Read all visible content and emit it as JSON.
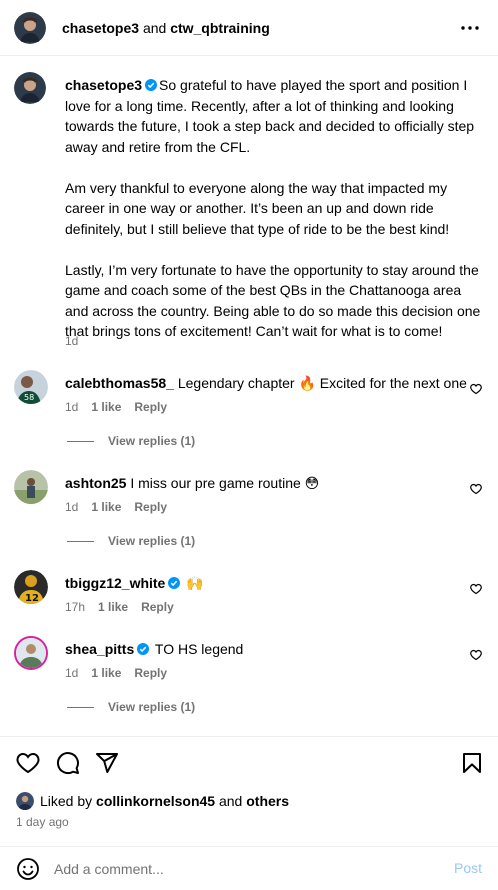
{
  "header": {
    "author": "chasetope3",
    "connector": "and",
    "collaborator": "ctw_qbtraining",
    "more_icon": "more-horizontal-icon"
  },
  "caption": {
    "username": "chasetope3",
    "paragraphs": [
      "So grateful to have played the sport and position I love for a long time. Recently, after a lot of thinking and looking towards the future, I took a step back and decided to officially step away and retire from the CFL.",
      "Am very thankful to everyone along the way that impacted my career in one way or another. It’s been an up and down ride definitely, but I still believe that type of ride to be the best kind!",
      "Lastly, I’m very fortunate to have the opportunity to stay around the game and coach some of the best QBs in the Chattanooga area and across the country. Being able to do so made this decision one that brings tons of excitement! Can’t wait for what is to come!"
    ],
    "time": "1d"
  },
  "comments": [
    {
      "username": "calebthomas58_",
      "verified": false,
      "text": "Legendary chapter 🔥 Excited for the next one",
      "time": "1d",
      "likes": "1 like",
      "reply": "Reply",
      "view_replies": "View replies (1)"
    },
    {
      "username": "ashton25",
      "verified": false,
      "text": "I miss our pre game routine 😳",
      "time": "1d",
      "likes": "1 like",
      "reply": "Reply",
      "view_replies": "View replies (1)"
    },
    {
      "username": "tbiggz12_white",
      "verified": true,
      "text": "🙌",
      "time": "17h",
      "likes": "1 like",
      "reply": "Reply",
      "view_replies": ""
    },
    {
      "username": "shea_pitts",
      "verified": true,
      "text": "TO HS legend",
      "time": "1d",
      "likes": "1 like",
      "reply": "Reply",
      "view_replies": "View replies (1)"
    }
  ],
  "actions": {
    "icons": [
      "heart-icon",
      "comment-icon",
      "share-icon",
      "bookmark-icon"
    ]
  },
  "likes": {
    "prefix": "Liked by",
    "user": "collinkornelson45",
    "connector": "and",
    "others": "others"
  },
  "post_time": "1 day ago",
  "add_comment": {
    "placeholder": "Add a comment...",
    "post_label": "Post"
  },
  "colors": {
    "verified": "#0095f6",
    "secondary_text": "#737373",
    "post_disabled": "#9ac7f5",
    "separator": "#efefef"
  }
}
